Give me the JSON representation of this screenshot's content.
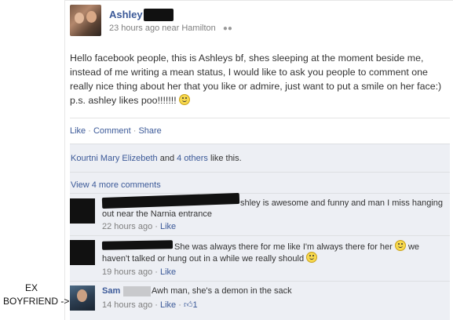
{
  "post": {
    "author": "Ashley",
    "time": "23 hours ago near Hamilton",
    "status_text": "Hello facebook people, this is Ashleys bf, shes sleeping at the moment beside me, instead of me writing a mean status, I would like to ask you people to comment one really nice thing about her that you like or admire, just want to put a smile on her face:) p.s. ashley likes poo!!!!!!!",
    "actions": {
      "like": "Like",
      "comment": "Comment",
      "share": "Share",
      "sep": " · "
    }
  },
  "likes": {
    "names": "Kourtni Mary Elizebeth",
    "and": " and ",
    "others": "4 others",
    "suffix": " like this."
  },
  "view_more": "View 4 more comments",
  "comments": [
    {
      "text_line1": "shley is awesome and funny and man I miss hanging",
      "text_line2": "out near the Narnia entrance",
      "time": "22 hours ago",
      "like": "Like"
    },
    {
      "text_line1": "She was always there for me like I'm always there for her",
      "text_line1_end": "we",
      "text_line2": "haven't talked or hung out in a while we really should",
      "time": "19 hours ago",
      "like": "Like"
    },
    {
      "name": "Sam",
      "text": "Awh man, she's a demon in the sack",
      "time": "14 hours ago",
      "like": "Like",
      "like_count": "1"
    }
  ],
  "annotation": {
    "line1": "EX",
    "line2": "BOYFRIEND ->"
  },
  "icons": [
    "people-icon",
    "smiley-icon",
    "thumbs-up-icon"
  ],
  "colors": {
    "link": "#3b5998",
    "panel": "#edeff4",
    "meta": "#7f7f7f"
  }
}
